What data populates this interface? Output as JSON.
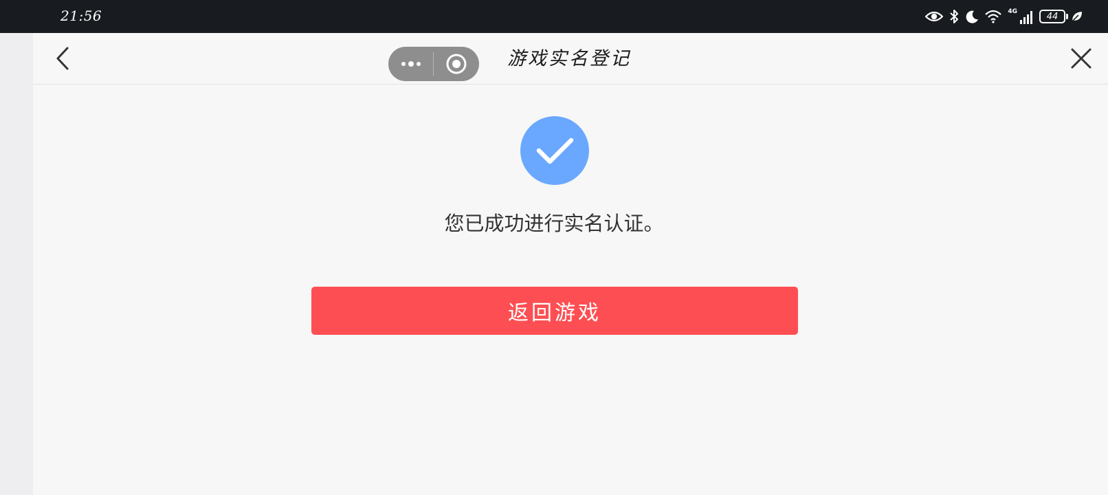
{
  "status_bar": {
    "time": "21:56",
    "network": "4G",
    "battery": "44",
    "icons": [
      "eye-icon",
      "bluetooth-icon",
      "moon-icon",
      "wifi-icon",
      "cell-signal-icon",
      "battery-icon",
      "leaf-icon"
    ]
  },
  "nav": {
    "title": "游戏实名登记",
    "back_icon": "chevron-left-icon",
    "more_icon": "more-dots-icon",
    "capsule_close_icon": "target-circle-icon",
    "close_icon": "close-icon"
  },
  "main": {
    "success_icon": "checkmark-icon",
    "message": "您已成功进行实名认证。",
    "return_button_label": "返回游戏"
  },
  "colors": {
    "status_bar_bg": "#181c20",
    "page_bg": "#f7f7f7",
    "success_blue": "#6aa8ff",
    "button_red": "#fd4f53",
    "capsule_gray": "#8e8e8e"
  }
}
